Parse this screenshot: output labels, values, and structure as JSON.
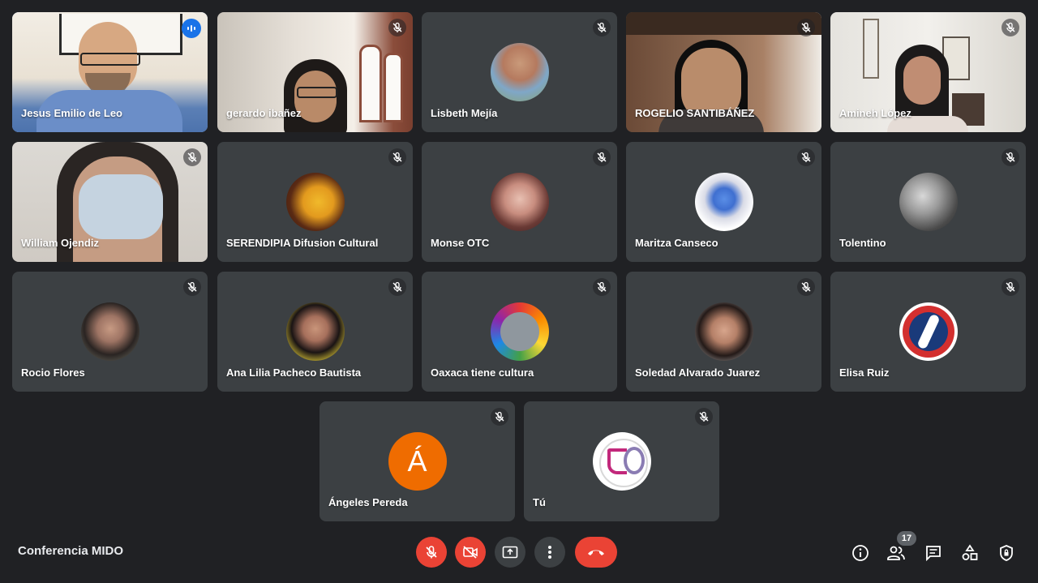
{
  "meeting": {
    "title": "Conferencia MIDO",
    "participant_count": "17"
  },
  "participants": [
    {
      "name": "Jesus Emilio de Leo",
      "type": "video",
      "speaking": true
    },
    {
      "name": "gerardo ibañez",
      "type": "video",
      "muted": true
    },
    {
      "name": "Lisbeth Mejía",
      "type": "avatar",
      "muted": true
    },
    {
      "name": "ROGELIO SANTIBÁÑEZ",
      "type": "video",
      "muted": true
    },
    {
      "name": "Amineh López",
      "type": "video",
      "muted": true
    },
    {
      "name": "William Ojendiz",
      "type": "video",
      "muted": true
    },
    {
      "name": "SERENDIPIA Difusion Cultural",
      "type": "avatar",
      "muted": true
    },
    {
      "name": "Monse OTC",
      "type": "avatar",
      "muted": true
    },
    {
      "name": "Maritza Canseco",
      "type": "avatar",
      "muted": true
    },
    {
      "name": "Tolentino",
      "type": "avatar",
      "muted": true
    },
    {
      "name": "Rocio Flores",
      "type": "avatar",
      "muted": true
    },
    {
      "name": "Ana Lilia Pacheco Bautista",
      "type": "avatar",
      "muted": true
    },
    {
      "name": "Oaxaca tiene cultura",
      "type": "avatar",
      "muted": true
    },
    {
      "name": "Soledad Alvarado Juarez",
      "type": "avatar",
      "muted": true
    },
    {
      "name": "Elisa Ruiz",
      "type": "avatar",
      "muted": true
    },
    {
      "name": "Ángeles Pereda",
      "type": "letter",
      "letter": "Á",
      "muted": true
    },
    {
      "name": "Tú",
      "type": "avatar",
      "muted": true
    }
  ],
  "icons": {
    "mic": "mic-off-icon",
    "cam": "videocam-off-icon",
    "present": "present-screen-icon",
    "more": "more-vert-icon",
    "hangup": "call-end-icon",
    "info": "info-icon",
    "people": "people-icon",
    "chat": "chat-icon",
    "activities": "activities-icon",
    "safety": "host-controls-icon"
  },
  "colors": {
    "background": "#202124",
    "tile": "#3c4043",
    "accent": "#8ab4f8",
    "red": "#ea4335",
    "speaking": "#1a73e8",
    "letter_avatar": "#ef6c00"
  }
}
